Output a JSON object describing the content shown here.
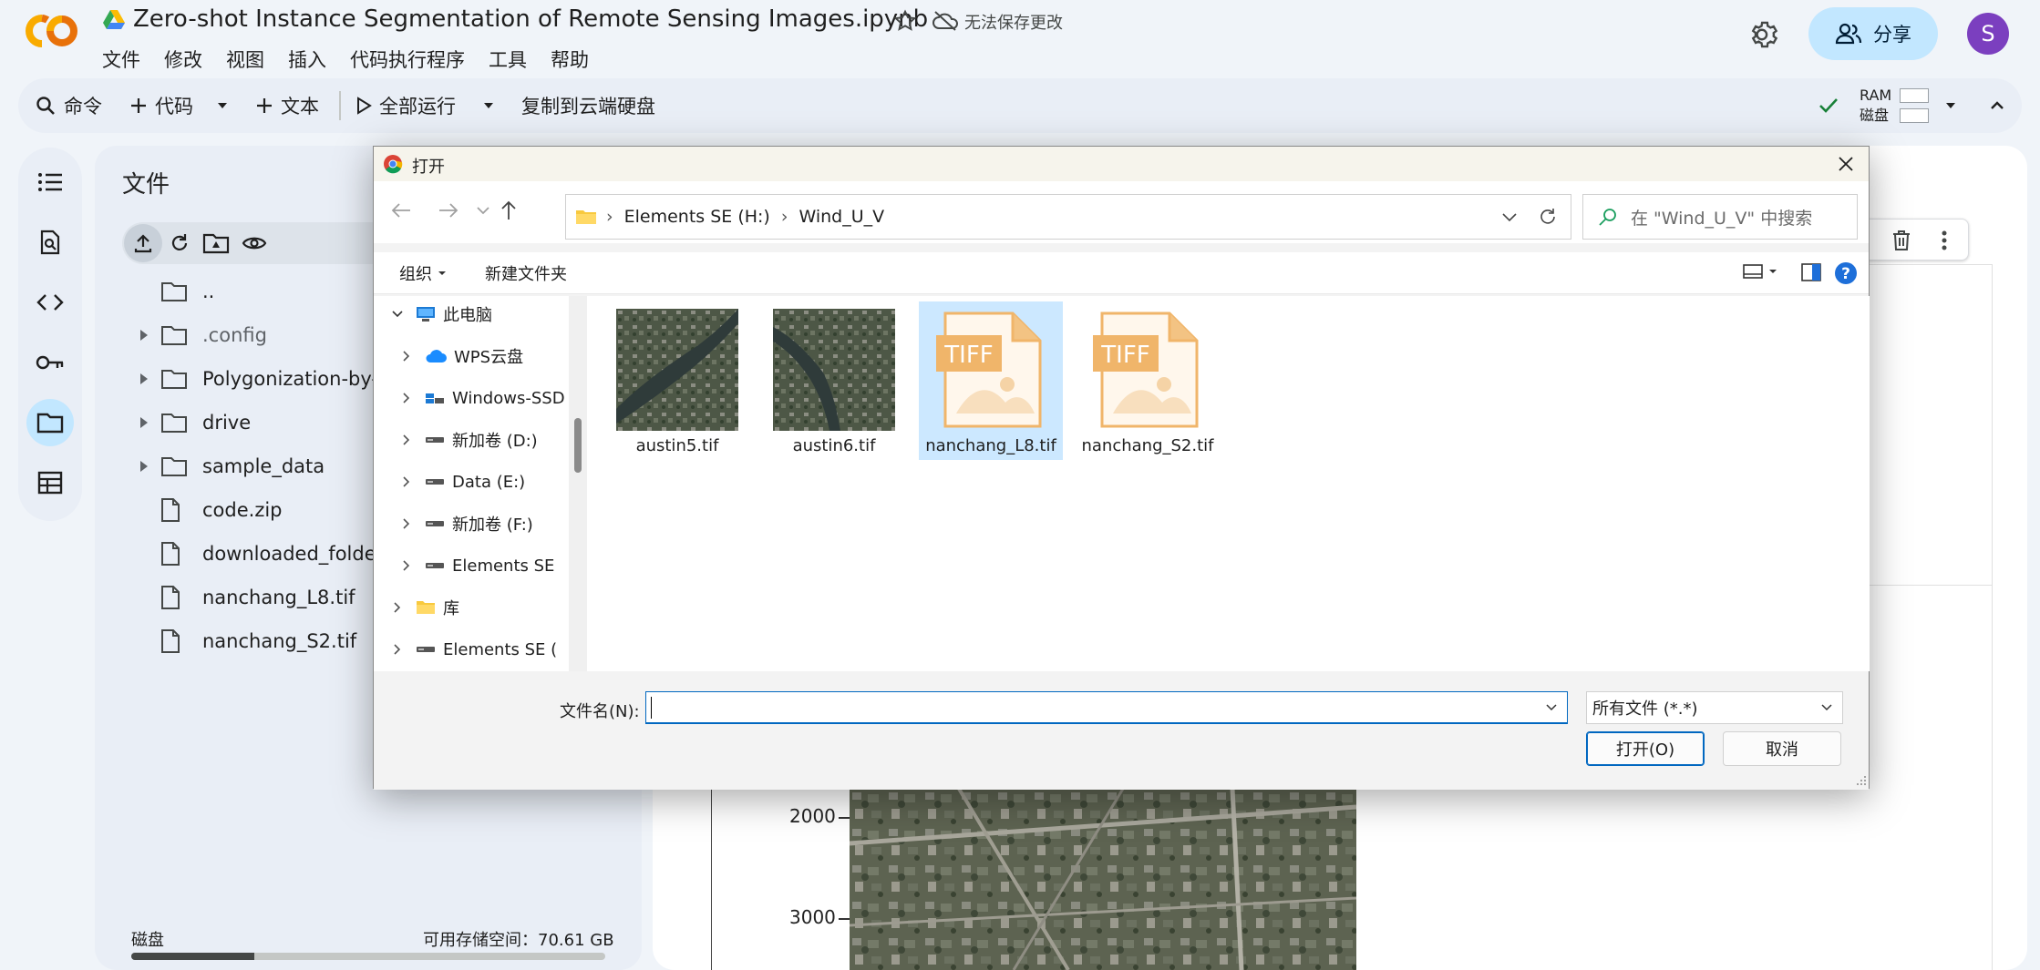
{
  "header": {
    "logo": "CO",
    "drive_icon": "google-drive-icon",
    "title": "Zero-shot Instance Segmentation of Remote Sensing Images.ipynb",
    "save_status": "无法保存更改",
    "menu": [
      "文件",
      "修改",
      "视图",
      "插入",
      "代码执行程序",
      "工具",
      "帮助"
    ],
    "share_label": "分享",
    "avatar_letter": "S"
  },
  "toolbar": {
    "command": "命令",
    "code": "代码",
    "text": "文本",
    "run_all": "全部运行",
    "copy_to_drive": "复制到云端硬盘",
    "ram": "RAM",
    "disk": "磁盘"
  },
  "files_panel": {
    "title": "文件",
    "tree": [
      {
        "name": "..",
        "type": "folder",
        "expandable": false
      },
      {
        "name": ".config",
        "type": "folder",
        "expandable": true,
        "muted": true
      },
      {
        "name": "Polygonization-by-Fr",
        "type": "folder",
        "expandable": true
      },
      {
        "name": "drive",
        "type": "folder",
        "expandable": true
      },
      {
        "name": "sample_data",
        "type": "folder",
        "expandable": true
      },
      {
        "name": "code.zip",
        "type": "file",
        "expandable": false
      },
      {
        "name": "downloaded_folder.zi",
        "type": "file",
        "expandable": false
      },
      {
        "name": "nanchang_L8.tif",
        "type": "file",
        "expandable": false
      },
      {
        "name": "nanchang_S2.tif",
        "type": "file",
        "expandable": false
      }
    ],
    "disk_label": "磁盘",
    "disk_free": "可用存储空间：70.61 GB",
    "disk_used_fraction": 0.26
  },
  "plot": {
    "yticks": [
      "2000",
      "3000"
    ]
  },
  "dialog": {
    "title": "打开",
    "breadcrumb": [
      "Elements SE (H:)",
      "Wind_U_V"
    ],
    "search_placeholder": "在 \"Wind_U_V\" 中搜索",
    "organize": "组织",
    "new_folder": "新建文件夹",
    "nav_tree": [
      {
        "label": "此电脑",
        "icon": "computer-icon",
        "level": 0,
        "expanded": true
      },
      {
        "label": "WPS云盘",
        "icon": "wps-cloud-icon",
        "level": 1
      },
      {
        "label": "Windows-SSD",
        "icon": "windows-drive-icon",
        "level": 1
      },
      {
        "label": "新加卷 (D:)",
        "icon": "drive-icon",
        "level": 1
      },
      {
        "label": "Data (E:)",
        "icon": "drive-icon",
        "level": 1
      },
      {
        "label": "新加卷 (F:)",
        "icon": "drive-icon",
        "level": 1
      },
      {
        "label": "Elements SE",
        "icon": "drive-icon",
        "level": 1
      },
      {
        "label": "库",
        "icon": "library-folder-icon",
        "level": 0
      },
      {
        "label": "Elements SE (",
        "icon": "drive-icon",
        "level": 0
      }
    ],
    "files": [
      {
        "name": "austin5.tif",
        "kind": "image",
        "selected": false
      },
      {
        "name": "austin6.tif",
        "kind": "image",
        "selected": false
      },
      {
        "name": "nanchang_L8.tif",
        "kind": "tiff",
        "selected": true
      },
      {
        "name": "nanchang_S2.tif",
        "kind": "tiff",
        "selected": false
      }
    ],
    "tiff_badge": "TIFF",
    "filename_label": "文件名(N):",
    "filename_value": "",
    "filetype": "所有文件 (*.*)",
    "open_button": "打开(O)",
    "cancel_button": "取消"
  }
}
